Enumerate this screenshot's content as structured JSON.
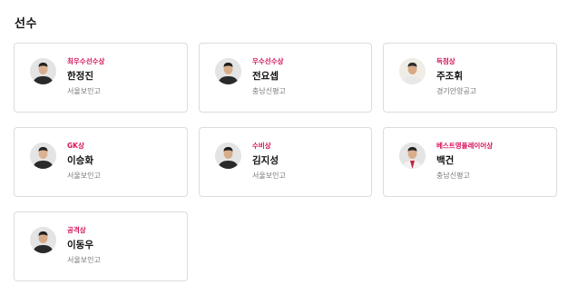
{
  "section": {
    "title": "선수"
  },
  "colors": {
    "award": "#d4135a",
    "card_border": "#dcdcdc",
    "school": "#777777"
  },
  "players": [
    {
      "award": "최우수선수상",
      "name": "한정진",
      "school": "서울보인고",
      "icon": "player-photo"
    },
    {
      "award": "우수선수상",
      "name": "전요셉",
      "school": "충남신평고",
      "icon": "player-photo"
    },
    {
      "award": "득점상",
      "name": "주조휘",
      "school": "경기안양공고",
      "icon": "player-photo"
    },
    {
      "award": "GK상",
      "name": "이승화",
      "school": "서울보인고",
      "icon": "player-photo"
    },
    {
      "award": "수비상",
      "name": "김지성",
      "school": "서울보인고",
      "icon": "player-photo"
    },
    {
      "award": "베스트영플레이어상",
      "name": "백건",
      "school": "충남신평고",
      "icon": "player-photo"
    },
    {
      "award": "공격상",
      "name": "이동우",
      "school": "서울보인고",
      "icon": "player-photo"
    }
  ]
}
